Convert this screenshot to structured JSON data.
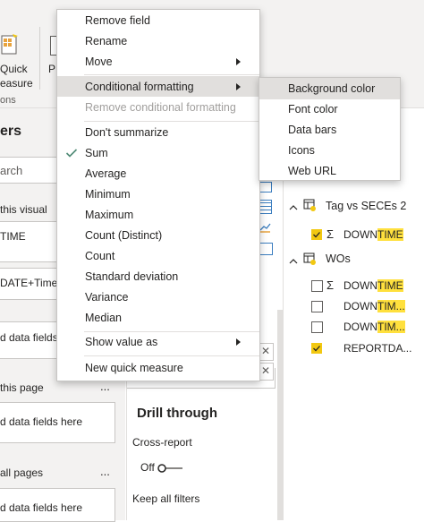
{
  "ribbon": {
    "quick_measure_line1": "Quick",
    "quick_measure_line2": "easure",
    "partial_p": "P",
    "calcs_label": "ons"
  },
  "filters": {
    "title": "ers",
    "search_placeholder": "arch",
    "section_visual": "this visual",
    "field_downtime": "TIME",
    "field_date": "DATE+Time",
    "add_fields_visual": "d data fields",
    "section_page": "this page",
    "page_more": "...",
    "add_fields_page": "d data fields here",
    "section_all": "all pages",
    "all_more": "...",
    "add_fields_all": "d data fields here"
  },
  "viz": {
    "drill_title": "Drill through",
    "cross_report_label": "Cross-report",
    "toggle_off": "Off",
    "keep_filters": "Keep all filters",
    "close_glyph": "✕"
  },
  "fields": {
    "table1": {
      "name": "Tag vs SECEs 2",
      "items": [
        {
          "pre": "DOWN",
          "hl": "TIME",
          "checked": true,
          "sigma": true
        }
      ]
    },
    "table2": {
      "name": "WOs",
      "items": [
        {
          "pre": "DOWN",
          "hl": "TIME",
          "checked": false,
          "sigma": true
        },
        {
          "pre": "DOWN",
          "hl": "TIM...",
          "checked": false,
          "sigma": false
        },
        {
          "pre": "DOWN",
          "hl": "TIM...",
          "checked": false,
          "sigma": false
        },
        {
          "pre": "REPORTDA...",
          "hl": "",
          "checked": true,
          "sigma": false
        }
      ]
    }
  },
  "context_menu": {
    "remove_field": "Remove field",
    "rename": "Rename",
    "move": "Move",
    "conditional_formatting": "Conditional formatting",
    "remove_conditional": "Remove conditional formatting",
    "dont_summarize": "Don't summarize",
    "sum": "Sum",
    "average": "Average",
    "minimum": "Minimum",
    "maximum": "Maximum",
    "count_distinct": "Count (Distinct)",
    "count": "Count",
    "std_dev": "Standard deviation",
    "variance": "Variance",
    "median": "Median",
    "show_value_as": "Show value as",
    "new_quick_measure": "New quick measure",
    "selected": "Sum"
  },
  "submenu": {
    "background_color": "Background color",
    "font_color": "Font color",
    "data_bars": "Data bars",
    "icons": "Icons",
    "web_url": "Web URL"
  },
  "colors": {
    "accent_yellow": "#f2c811",
    "highlight": "#ffe03d",
    "check_green": "#4f8a75",
    "hover_grey": "#e1dfdd"
  }
}
